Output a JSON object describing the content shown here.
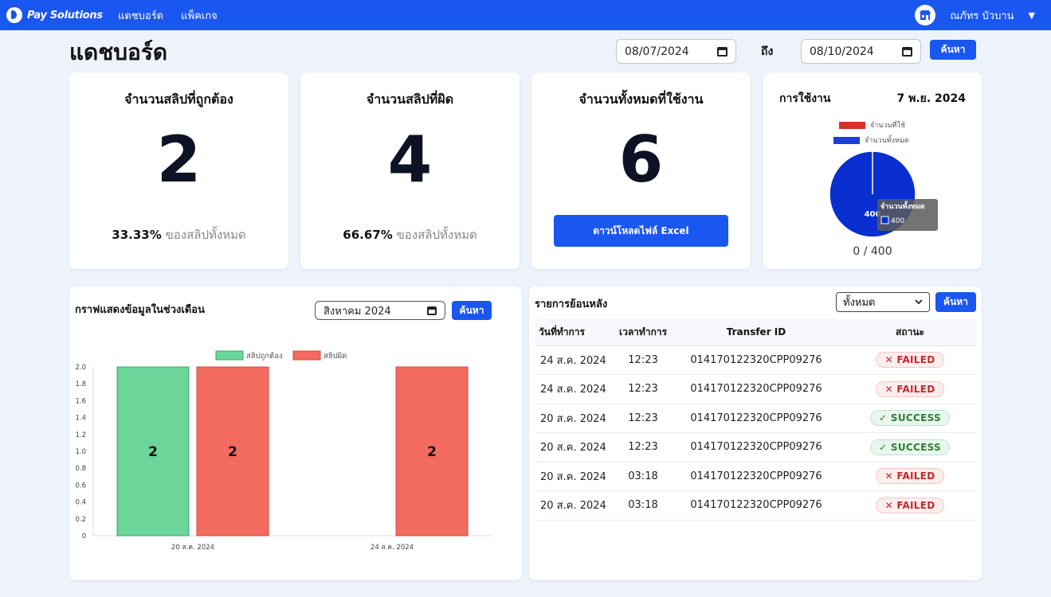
{
  "nav": {
    "brand": "Pay Solutions",
    "links": [
      "แดชบอร์ด",
      "แพ็คเกจ"
    ],
    "user_name": "ณภัทร บัวบาน",
    "caret": "▼"
  },
  "header": {
    "title": "แดชบอร์ด",
    "date_from": "08/07/2024",
    "to_label": "ถึง",
    "date_to": "08/10/2024",
    "search_label": "ค้นหา"
  },
  "stats": [
    {
      "title": "จำนวนสลิปที่ถูกต้อง",
      "value": "2",
      "percent": "33.33%",
      "suffix": "ของสลิปทั้งหมด"
    },
    {
      "title": "จำนวนสลิปที่ผิด",
      "value": "4",
      "percent": "66.67%",
      "suffix": "ของสลิปทั้งหมด"
    },
    {
      "title": "จำนวนทั้งหมดที่ใช้งาน",
      "value": "6",
      "button": "ดาวน์โหลดไฟล์ Excel"
    }
  ],
  "usage": {
    "title": "การใช้งาน",
    "date": "7 พ.ย. 2024",
    "legend": [
      {
        "label": "จำนวนที่ใช้",
        "color": "#d93025"
      },
      {
        "label": "จำนวนทั้งหมด",
        "color": "#1a3fd6"
      }
    ],
    "pie_label": "400",
    "tooltip_title": "จำนวนทั้งหมด",
    "tooltip_value": "400",
    "count": "0 / 400",
    "used": 0,
    "total": 400
  },
  "monthly_chart": {
    "title": "กราฟแสดงข้อมูลในช่วงเดือน",
    "month_value": "สิงหาคม 2024",
    "search_label": "ค้นหา"
  },
  "chart_data": {
    "type": "bar",
    "categories": [
      "20 ส.ค. 2024",
      "24 ส.ค. 2024"
    ],
    "series": [
      {
        "name": "สลิปถูกต้อง",
        "values": [
          2,
          0
        ],
        "color": "#6cd59a"
      },
      {
        "name": "สลิปผิด",
        "values": [
          2,
          2
        ],
        "color": "#f26b5e"
      }
    ],
    "ylim": [
      0,
      2.0
    ],
    "yticks": [
      "2.0",
      "1.8",
      "1.6",
      "1.4",
      "1.2",
      "1.0",
      "0.8",
      "0.6",
      "0.4",
      "0.2",
      "0"
    ],
    "legend_position": "top-center",
    "data_labels": true
  },
  "history": {
    "title": "รายการย้อนหลัง",
    "filter_value": "ทั้งหมด",
    "search_label": "ค้นหา",
    "columns": [
      "วันที่ทำการ",
      "เวลาทำการ",
      "Transfer ID",
      "สถานะ"
    ],
    "rows": [
      {
        "date": "24 ส.ค. 2024",
        "time": "12:23",
        "id": "014170122320CPP09276",
        "status": "FAILED",
        "icon": "✕"
      },
      {
        "date": "24 ส.ค. 2024",
        "time": "12:23",
        "id": "014170122320CPP09276",
        "status": "FAILED",
        "icon": "✕"
      },
      {
        "date": "20 ส.ค. 2024",
        "time": "12:23",
        "id": "014170122320CPP09276",
        "status": "SUCCESS",
        "icon": "✓"
      },
      {
        "date": "20 ส.ค. 2024",
        "time": "12:23",
        "id": "014170122320CPP09276",
        "status": "SUCCESS",
        "icon": "✓"
      },
      {
        "date": "20 ส.ค. 2024",
        "time": "03:18",
        "id": "014170122320CPP09276",
        "status": "FAILED",
        "icon": "✕"
      },
      {
        "date": "20 ส.ค. 2024",
        "time": "03:18",
        "id": "014170122320CPP09276",
        "status": "FAILED",
        "icon": "✕"
      }
    ]
  }
}
